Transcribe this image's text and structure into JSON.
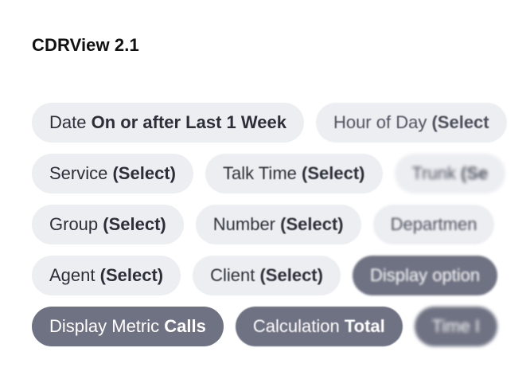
{
  "app": {
    "title": "CDRView 2.1"
  },
  "filters": {
    "rows": [
      [
        {
          "label": "Date",
          "value": "On or after Last 1 Week"
        },
        {
          "label": "Hour of Day",
          "value": "(Select"
        }
      ],
      [
        {
          "label": "Service",
          "value": "(Select)"
        },
        {
          "label": "Talk Time",
          "value": "(Select)"
        },
        {
          "label": "Trunk",
          "value": "(Se"
        }
      ],
      [
        {
          "label": "Group",
          "value": "(Select)"
        },
        {
          "label": "Number",
          "value": "(Select)"
        },
        {
          "label": "Departmen",
          "value": ""
        }
      ],
      [
        {
          "label": "Agent",
          "value": "(Select)"
        },
        {
          "label": "Client",
          "value": "(Select)"
        },
        {
          "label": "Display option",
          "value": ""
        }
      ],
      [
        {
          "label": "Display Metric",
          "value": "Calls"
        },
        {
          "label": "Calculation",
          "value": "Total"
        },
        {
          "label": "Time I",
          "value": ""
        }
      ]
    ]
  },
  "colors": {
    "chip_background": "#edeef2",
    "chip_dark_background": "#6f7282",
    "chip_text": "#2d2f38",
    "chip_dark_text": "#ffffff"
  }
}
